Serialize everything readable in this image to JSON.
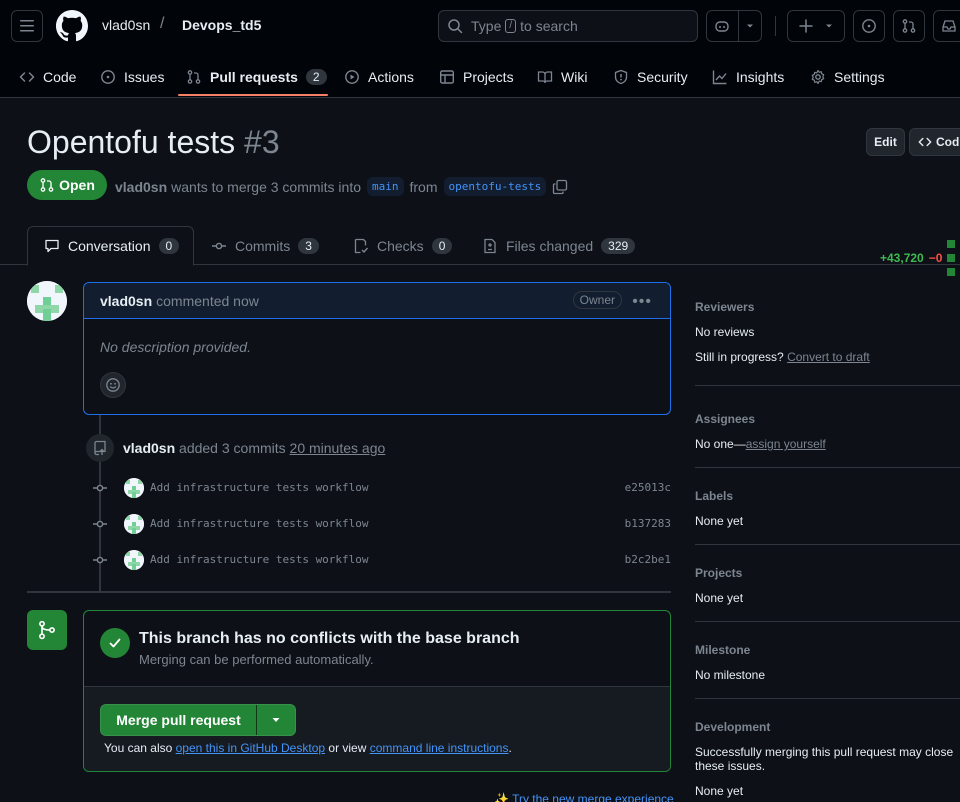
{
  "header": {
    "owner": "vlad0sn",
    "separator": "/",
    "repo": "Devops_td5",
    "search_prefix": "Type",
    "search_key": "/",
    "search_suffix": "to search"
  },
  "nav": {
    "tabs": [
      {
        "label": "Code",
        "icon": "code-icon"
      },
      {
        "label": "Issues",
        "icon": "issue-icon"
      },
      {
        "label": "Pull requests",
        "icon": "pull-request-icon",
        "count": "2",
        "active": true
      },
      {
        "label": "Actions",
        "icon": "play-icon"
      },
      {
        "label": "Projects",
        "icon": "table-icon"
      },
      {
        "label": "Wiki",
        "icon": "book-icon"
      },
      {
        "label": "Security",
        "icon": "shield-icon"
      },
      {
        "label": "Insights",
        "icon": "graph-icon"
      },
      {
        "label": "Settings",
        "icon": "gear-icon"
      }
    ]
  },
  "pr": {
    "title": "Opentofu tests",
    "number": "#3",
    "edit_label": "Edit",
    "code_label": "Cod",
    "state": "Open",
    "author": "vlad0sn",
    "merge_text": "wants to merge 3 commits into",
    "base_branch": "main",
    "from_text": "from",
    "head_branch": "opentofu-tests"
  },
  "pr_tabs": [
    {
      "label": "Conversation",
      "count": "0",
      "icon": "comment-icon"
    },
    {
      "label": "Commits",
      "count": "3",
      "icon": "commit-icon"
    },
    {
      "label": "Checks",
      "count": "0",
      "icon": "checklist-icon"
    },
    {
      "label": "Files changed",
      "count": "329",
      "icon": "file-diff-icon"
    }
  ],
  "diffstat": {
    "additions": "+43,720",
    "deletions": "−0"
  },
  "comment": {
    "author": "vlad0sn",
    "action": "commented now",
    "role": "Owner",
    "body": "No description provided."
  },
  "push_event": {
    "author": "vlad0sn",
    "action": "added 3 commits",
    "time": "20 minutes ago"
  },
  "commits": [
    {
      "message": "Add infrastructure tests workflow",
      "sha": "e25013c"
    },
    {
      "message": "Add infrastructure tests workflow",
      "sha": "b137283"
    },
    {
      "message": "Add infrastructure tests workflow",
      "sha": "b2c2be1"
    }
  ],
  "merge": {
    "title": "This branch has no conflicts with the base branch",
    "subtitle": "Merging can be performed automatically.",
    "button": "Merge pull request",
    "note_prefix": "You can also",
    "link_desktop": "open this in GitHub Desktop",
    "note_mid": "or view",
    "link_cli": "command line instructions",
    "note_end": ".",
    "try_new": "Try the new merge experience"
  },
  "sidebar": {
    "reviewers": {
      "heading": "Reviewers",
      "value": "No reviews",
      "draft_prefix": "Still in progress?",
      "draft_link": "Convert to draft"
    },
    "assignees": {
      "heading": "Assignees",
      "value": "No one—",
      "link": "assign yourself"
    },
    "labels": {
      "heading": "Labels",
      "value": "None yet"
    },
    "projects": {
      "heading": "Projects",
      "value": "None yet"
    },
    "milestone": {
      "heading": "Milestone",
      "value": "No milestone"
    },
    "development": {
      "heading": "Development",
      "value": "Successfully merging this pull request may close these issues.",
      "value2": "None yet"
    }
  },
  "colors": {
    "accent_green": "#238636",
    "link_blue": "#4493f8",
    "tab_underline": "#f78166",
    "background": "#0d1117"
  }
}
